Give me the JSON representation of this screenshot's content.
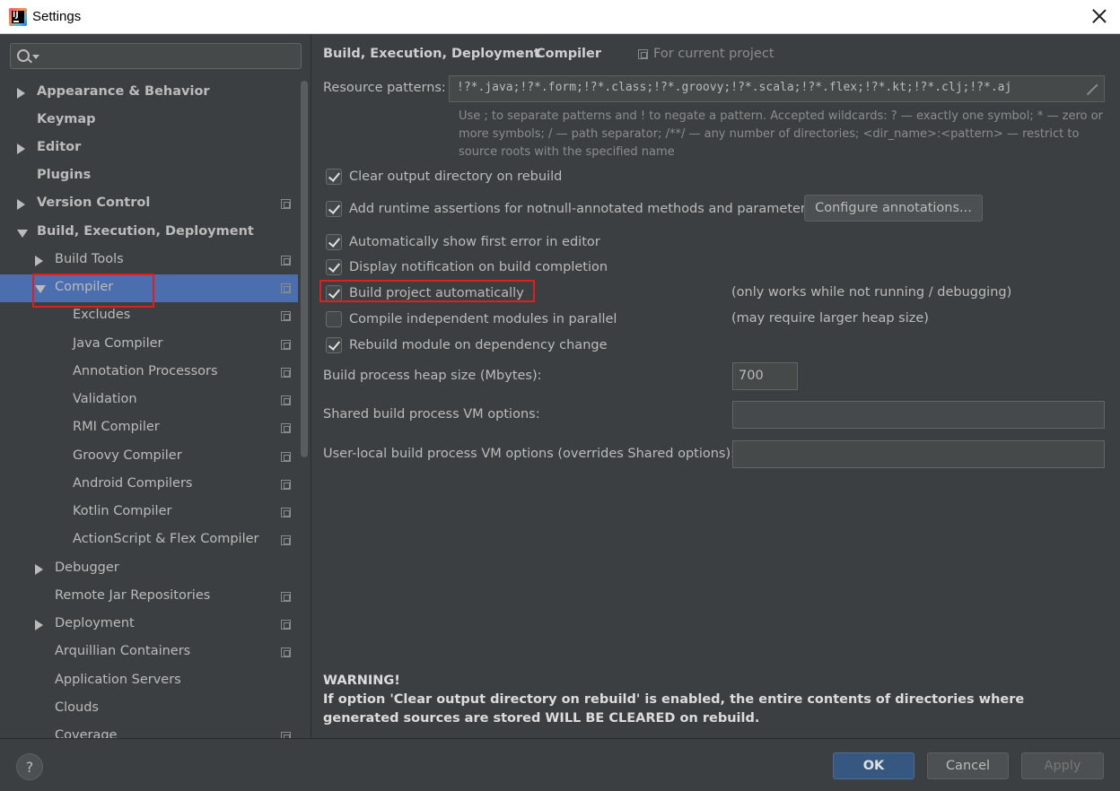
{
  "window": {
    "title": "Settings",
    "app_icon_text": "IJ"
  },
  "search": {
    "placeholder": ""
  },
  "tree": [
    {
      "label": "Appearance & Behavior",
      "bold": true,
      "expander": "collapsed",
      "project_icon": false
    },
    {
      "label": "Keymap",
      "bold": true,
      "expander": "none",
      "project_icon": false
    },
    {
      "label": "Editor",
      "bold": true,
      "expander": "collapsed",
      "project_icon": false
    },
    {
      "label": "Plugins",
      "bold": true,
      "expander": "none",
      "project_icon": false
    },
    {
      "label": "Version Control",
      "bold": true,
      "expander": "collapsed",
      "project_icon": true
    },
    {
      "label": "Build, Execution, Deployment",
      "bold": true,
      "expander": "expanded",
      "project_icon": false
    },
    {
      "label": "Build Tools",
      "bold": false,
      "expander": "collapsed",
      "project_icon": true
    },
    {
      "label": "Compiler",
      "bold": false,
      "expander": "expanded",
      "project_icon": true,
      "selected": true
    },
    {
      "label": "Excludes",
      "bold": false,
      "expander": "none",
      "project_icon": true
    },
    {
      "label": "Java Compiler",
      "bold": false,
      "expander": "none",
      "project_icon": true
    },
    {
      "label": "Annotation Processors",
      "bold": false,
      "expander": "none",
      "project_icon": true
    },
    {
      "label": "Validation",
      "bold": false,
      "expander": "none",
      "project_icon": true
    },
    {
      "label": "RMI Compiler",
      "bold": false,
      "expander": "none",
      "project_icon": true
    },
    {
      "label": "Groovy Compiler",
      "bold": false,
      "expander": "none",
      "project_icon": true
    },
    {
      "label": "Android Compilers",
      "bold": false,
      "expander": "none",
      "project_icon": true
    },
    {
      "label": "Kotlin Compiler",
      "bold": false,
      "expander": "none",
      "project_icon": true
    },
    {
      "label": "ActionScript & Flex Compiler",
      "bold": false,
      "expander": "none",
      "project_icon": true
    },
    {
      "label": "Debugger",
      "bold": false,
      "expander": "collapsed",
      "project_icon": false
    },
    {
      "label": "Remote Jar Repositories",
      "bold": false,
      "expander": "none",
      "project_icon": true
    },
    {
      "label": "Deployment",
      "bold": false,
      "expander": "collapsed",
      "project_icon": true
    },
    {
      "label": "Arquillian Containers",
      "bold": false,
      "expander": "none",
      "project_icon": true
    },
    {
      "label": "Application Servers",
      "bold": false,
      "expander": "none",
      "project_icon": false
    },
    {
      "label": "Clouds",
      "bold": false,
      "expander": "none",
      "project_icon": false
    },
    {
      "label": "Coverage",
      "bold": false,
      "expander": "none",
      "project_icon": true
    }
  ],
  "breadcrumb": {
    "parent": "Build, Execution, Deployment",
    "separator": "›",
    "current": "Compiler",
    "scope": "For current project"
  },
  "resource_patterns": {
    "label": "Resource patterns:",
    "value": "!?*.java;!?*.form;!?*.class;!?*.groovy;!?*.scala;!?*.flex;!?*.kt;!?*.clj;!?*.aj",
    "hint": "Use ; to separate patterns and ! to negate a pattern. Accepted wildcards: ? — exactly one symbol; * — zero or more symbols; / — path separator; /**/ — any number of directories; <dir_name>:<pattern> — restrict to source roots with the specified name"
  },
  "options": [
    {
      "label": "Clear output directory on rebuild",
      "checked": true,
      "note": ""
    },
    {
      "label": "Add runtime assertions for notnull-annotated methods and parameters",
      "checked": true,
      "note": ""
    },
    {
      "label": "Automatically show first error in editor",
      "checked": true,
      "note": ""
    },
    {
      "label": "Display notification on build completion",
      "checked": true,
      "note": ""
    },
    {
      "label": "Build project automatically",
      "checked": true,
      "note": "(only works while not running / debugging)"
    },
    {
      "label": "Compile independent modules in parallel",
      "checked": false,
      "note": "(may require larger heap size)"
    },
    {
      "label": "Rebuild module on dependency change",
      "checked": true,
      "note": ""
    }
  ],
  "configure_annotations_label": "Configure annotations...",
  "heap": {
    "label": "Build process heap size (Mbytes):",
    "value": "700"
  },
  "shared_vm": {
    "label": "Shared build process VM options:",
    "value": ""
  },
  "user_vm": {
    "label": "User-local build process VM options (overrides Shared options):",
    "value": ""
  },
  "warning": {
    "title": "WARNING!",
    "body": "If option 'Clear output directory on rebuild' is enabled, the entire contents of directories where generated sources are stored WILL BE CLEARED on rebuild."
  },
  "footer": {
    "help": "?",
    "ok": "OK",
    "cancel": "Cancel",
    "apply": "Apply"
  },
  "colors": {
    "background": "#3c3f41",
    "selection": "#4b6eaf",
    "highlight_box": "#e01e1e",
    "ok_button": "#365880"
  }
}
